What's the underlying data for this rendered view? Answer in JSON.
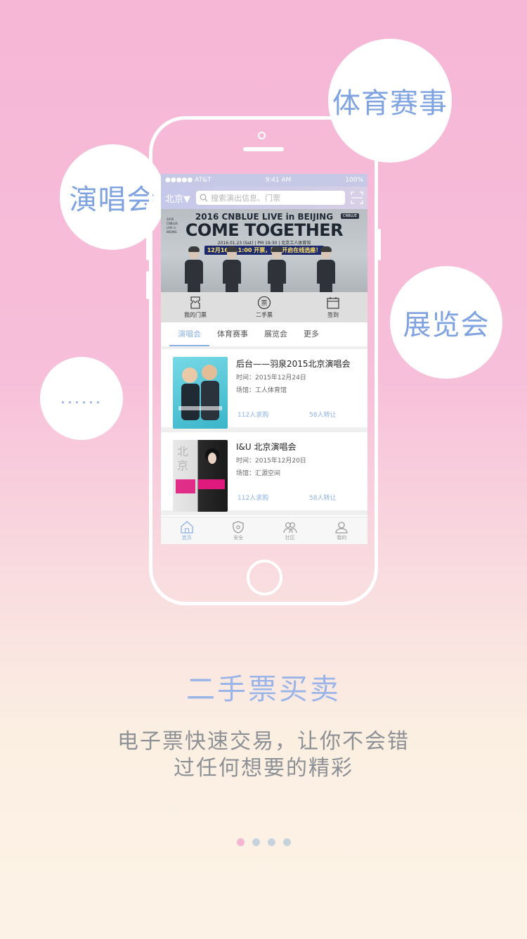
{
  "bubbles": {
    "sports": "体育赛事",
    "concert": "演唱会",
    "expo": "展览会",
    "more": "......"
  },
  "statusbar": {
    "carrier": "●●●●● AT&T",
    "time": "9:41 AM",
    "battery": "100%"
  },
  "navbar": {
    "city": "北京▼",
    "search_placeholder": "搜索演出信息、门票"
  },
  "banner": {
    "line1": "2016 CNBLUE LIVE in BEIJING",
    "logo": "CNBLUE",
    "side": "2016 CNBLUE LIVE in BEIJING",
    "title": "COME TOGETHER",
    "info": "2016.01.23 (Sat)  |  PM 19:30  |  北京工人体育馆",
    "strip": "12月16日11:00 开票，团步开启在线选座！"
  },
  "quick_actions": [
    {
      "label": "我的门票",
      "icon": "ticket-icon"
    },
    {
      "label": "二手票",
      "icon": "second-hand-ticket-icon"
    },
    {
      "label": "签到",
      "icon": "calendar-icon"
    }
  ],
  "tabs": [
    "演唱会",
    "体育赛事",
    "展览会",
    "更多"
  ],
  "events": [
    {
      "title": "后台——羽泉2015北京演唱会",
      "time": "时间：2015年12月24日",
      "venue": "场馆：工人体育馆",
      "buy": "112人求购",
      "transfer": "58人转让"
    },
    {
      "title": "I&U 北京演唱会",
      "time": "时间：2015年12月20日",
      "venue": "场馆：汇源空间",
      "buy": "112人求购",
      "transfer": "58人转让"
    }
  ],
  "tabbar": [
    {
      "label": "首页",
      "icon": "home-icon"
    },
    {
      "label": "安全",
      "icon": "shield-icon"
    },
    {
      "label": "社区",
      "icon": "community-icon"
    },
    {
      "label": "我的",
      "icon": "user-icon"
    }
  ],
  "headline": "二手票买卖",
  "description": [
    "电子票快速交易，让你不会错",
    "过任何想要的精彩"
  ],
  "pagination": {
    "total": 4,
    "active": 1
  },
  "colors": {
    "accent": "#8ab1e6",
    "headline": "#9bb5e8",
    "dot_active": "#f3b5d2",
    "dot_inactive": "#c7d3dc"
  }
}
